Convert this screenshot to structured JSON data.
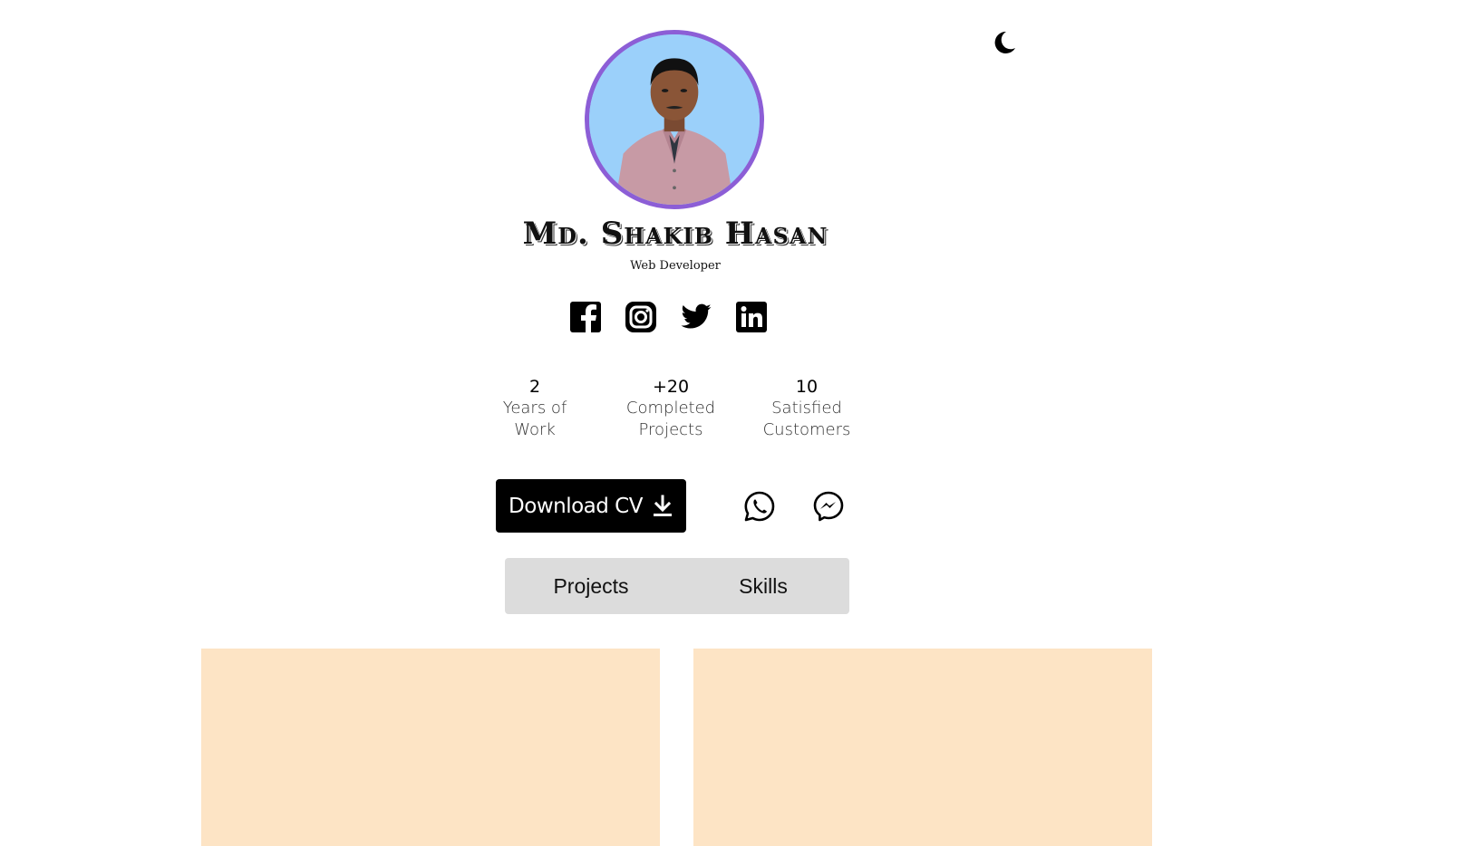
{
  "profile": {
    "name": "Md. Shakib Hasan",
    "role": "Web Developer"
  },
  "theme_toggle": {
    "icon": "moon-icon"
  },
  "socials": [
    {
      "name": "facebook",
      "icon": "facebook-icon"
    },
    {
      "name": "instagram",
      "icon": "instagram-icon"
    },
    {
      "name": "twitter",
      "icon": "twitter-icon"
    },
    {
      "name": "linkedin",
      "icon": "linkedin-icon"
    }
  ],
  "stats": [
    {
      "value": "2",
      "label_line1": "Years of",
      "label_line2": "Work"
    },
    {
      "value": "+20",
      "label_line1": "Completed",
      "label_line2": "Projects"
    },
    {
      "value": "10",
      "label_line1": "Satisfied",
      "label_line2": "Customers"
    }
  ],
  "actions": {
    "download_label": "Download CV",
    "download_icon": "download-icon",
    "whatsapp_icon": "whatsapp-icon",
    "messenger_icon": "messenger-icon"
  },
  "tabs": [
    {
      "label": "Projects"
    },
    {
      "label": "Skills"
    }
  ],
  "colors": {
    "avatar_ring": "#8c5ed6",
    "avatar_background": "#9bd0fa",
    "card_background": "#fde4c5",
    "tabs_background": "#dcdcdc",
    "button_background": "#000000"
  }
}
